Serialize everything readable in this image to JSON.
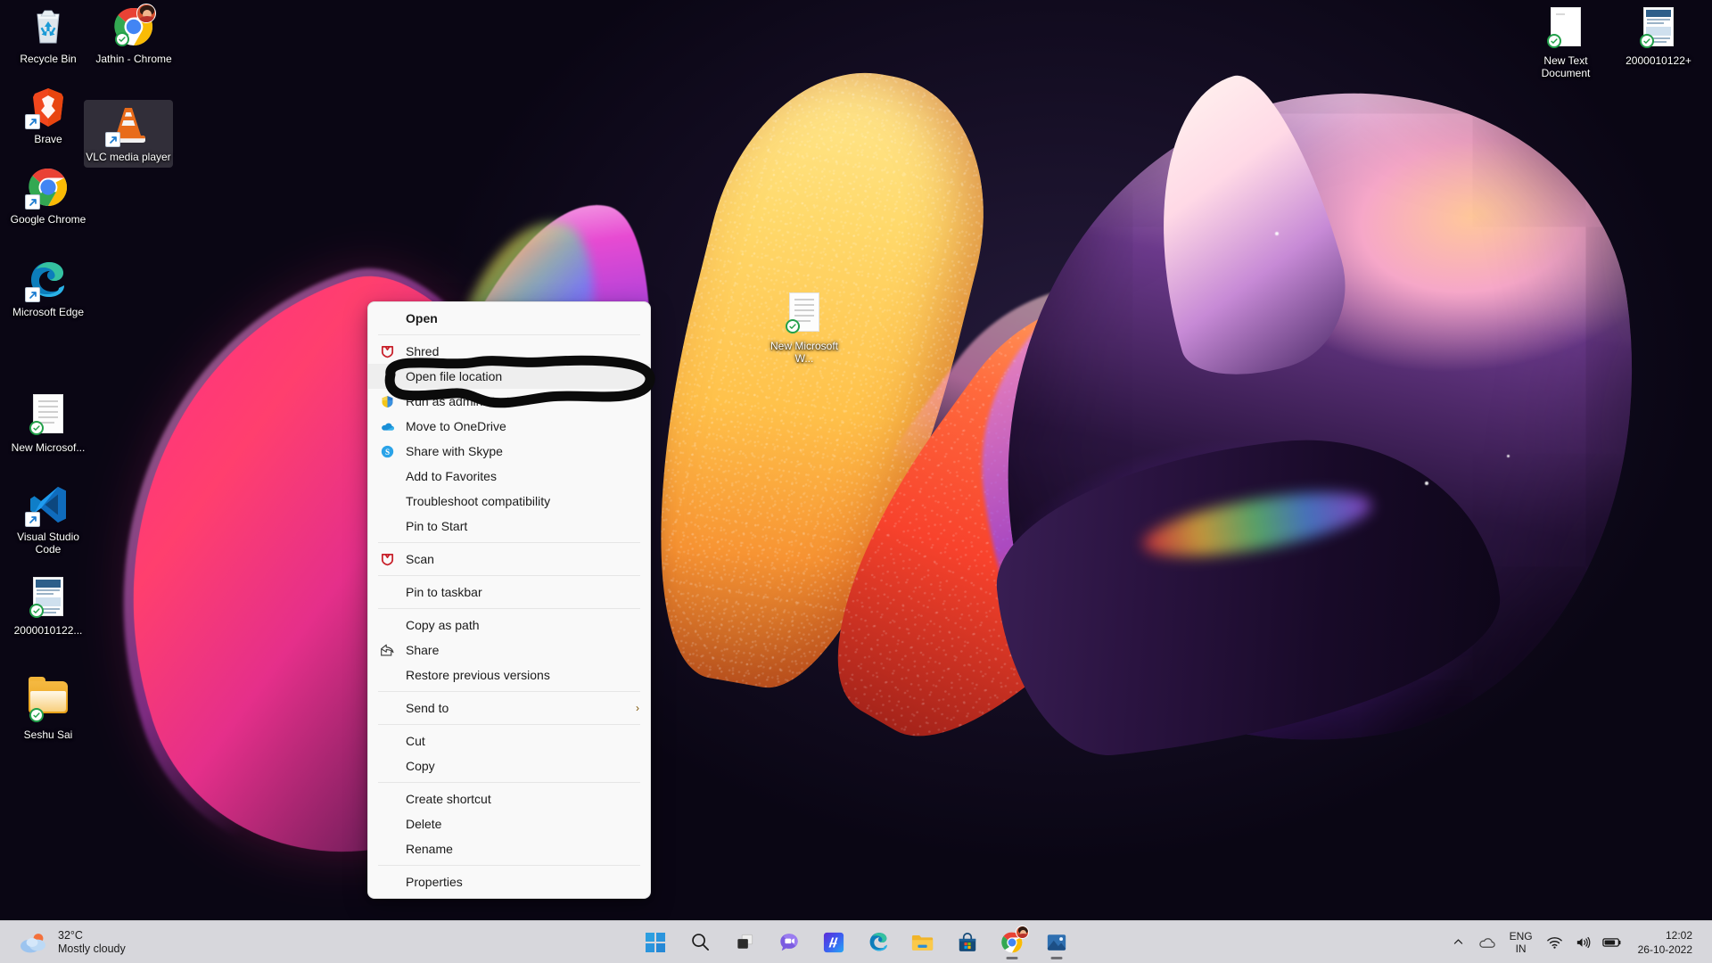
{
  "desktop": {
    "icons_left": [
      {
        "id": "recycle-bin",
        "label": "Recycle Bin",
        "type": "recycle",
        "shortcut": false,
        "sync": false,
        "selected": false
      },
      {
        "id": "brave",
        "label": "Brave",
        "type": "brave",
        "shortcut": true,
        "sync": false,
        "selected": false
      },
      {
        "id": "google-chrome",
        "label": "Google Chrome",
        "type": "chrome",
        "shortcut": true,
        "sync": false,
        "selected": false
      },
      {
        "id": "microsoft-edge",
        "label": "Microsoft Edge",
        "type": "edge",
        "shortcut": true,
        "sync": false,
        "selected": false
      },
      {
        "id": "new-microsoft-doc",
        "label": "New Microsof...",
        "type": "doc",
        "shortcut": false,
        "sync": true,
        "selected": false
      },
      {
        "id": "visual-studio-code",
        "label": "Visual Studio Code",
        "type": "vscode",
        "shortcut": true,
        "sync": false,
        "selected": false
      },
      {
        "id": "file-2000010122",
        "label": "2000010122...",
        "type": "image-doc",
        "shortcut": false,
        "sync": true,
        "selected": false
      },
      {
        "id": "seshu-sai-folder",
        "label": "Seshu Sai",
        "type": "folder",
        "shortcut": false,
        "sync": true,
        "selected": false
      }
    ],
    "icons_col2": [
      {
        "id": "jathin-chrome",
        "label": "Jathin - Chrome",
        "type": "chrome-profile",
        "shortcut": false,
        "sync": true,
        "selected": false
      },
      {
        "id": "vlc-media-player",
        "label": "VLC media player",
        "type": "vlc",
        "shortcut": true,
        "sync": false,
        "selected": true
      }
    ],
    "icons_center": [
      {
        "id": "new-microsoft-word",
        "label": "New Microsoft W...",
        "type": "doc",
        "shortcut": false,
        "sync": true,
        "selected": false
      }
    ],
    "icons_right": [
      {
        "id": "new-text-document",
        "label": "New Text Document",
        "type": "txt",
        "shortcut": false,
        "sync": true,
        "selected": false
      },
      {
        "id": "file-2000010122-plus",
        "label": "2000010122+",
        "type": "image-doc",
        "shortcut": false,
        "sync": true,
        "selected": false
      }
    ]
  },
  "context_menu": {
    "items": [
      {
        "label": "Open",
        "icon": "none",
        "bold": true,
        "highlighted": false,
        "submenu": false
      },
      {
        "separator": true
      },
      {
        "label": "Shred",
        "icon": "mcafee-shield",
        "bold": false,
        "highlighted": false,
        "submenu": false
      },
      {
        "label": "Open file location",
        "icon": "none",
        "bold": false,
        "highlighted": true,
        "submenu": false
      },
      {
        "label": "Run as administrator",
        "icon": "uac-shield",
        "bold": false,
        "highlighted": false,
        "submenu": false
      },
      {
        "label": "Move to OneDrive",
        "icon": "onedrive-cloud",
        "bold": false,
        "highlighted": false,
        "submenu": false
      },
      {
        "label": "Share with Skype",
        "icon": "skype",
        "bold": false,
        "highlighted": false,
        "submenu": false
      },
      {
        "label": "Add to Favorites",
        "icon": "none",
        "bold": false,
        "highlighted": false,
        "submenu": false
      },
      {
        "label": "Troubleshoot compatibility",
        "icon": "none",
        "bold": false,
        "highlighted": false,
        "submenu": false
      },
      {
        "label": "Pin to Start",
        "icon": "none",
        "bold": false,
        "highlighted": false,
        "submenu": false
      },
      {
        "separator": true
      },
      {
        "label": "Scan",
        "icon": "mcafee-shield",
        "bold": false,
        "highlighted": false,
        "submenu": false
      },
      {
        "separator": true
      },
      {
        "label": "Pin to taskbar",
        "icon": "none",
        "bold": false,
        "highlighted": false,
        "submenu": false
      },
      {
        "separator": true
      },
      {
        "label": "Copy as path",
        "icon": "none",
        "bold": false,
        "highlighted": false,
        "submenu": false
      },
      {
        "label": "Share",
        "icon": "share-arrow",
        "bold": false,
        "highlighted": false,
        "submenu": false
      },
      {
        "label": "Restore previous versions",
        "icon": "none",
        "bold": false,
        "highlighted": false,
        "submenu": false
      },
      {
        "separator": true
      },
      {
        "label": "Send to",
        "icon": "none",
        "bold": false,
        "highlighted": false,
        "submenu": true
      },
      {
        "separator": true
      },
      {
        "label": "Cut",
        "icon": "none",
        "bold": false,
        "highlighted": false,
        "submenu": false
      },
      {
        "label": "Copy",
        "icon": "none",
        "bold": false,
        "highlighted": false,
        "submenu": false
      },
      {
        "separator": true
      },
      {
        "label": "Create shortcut",
        "icon": "none",
        "bold": false,
        "highlighted": false,
        "submenu": false
      },
      {
        "label": "Delete",
        "icon": "none",
        "bold": false,
        "highlighted": false,
        "submenu": false
      },
      {
        "label": "Rename",
        "icon": "none",
        "bold": false,
        "highlighted": false,
        "submenu": false
      },
      {
        "separator": true
      },
      {
        "label": "Properties",
        "icon": "none",
        "bold": false,
        "highlighted": false,
        "submenu": false
      }
    ],
    "submenu_chevron": "›"
  },
  "annotation": {
    "kind": "hand-drawn-circle",
    "targets": "Open file location",
    "color": "#0a0a0a"
  },
  "taskbar": {
    "weather": {
      "temperature": "32°C",
      "condition": "Mostly cloudy",
      "icon": "sun-behind-cloud-icon"
    },
    "center_buttons": [
      {
        "id": "start",
        "name": "start-button",
        "label": "Start",
        "icon": "windows-logo",
        "active": false
      },
      {
        "id": "search",
        "name": "search-button",
        "label": "Search",
        "icon": "magnifier",
        "active": false
      },
      {
        "id": "task-view",
        "name": "task-view-button",
        "label": "Task View",
        "icon": "task-view",
        "active": false
      },
      {
        "id": "chat",
        "name": "chat-button",
        "label": "Chat",
        "icon": "chat-bubble",
        "active": false
      },
      {
        "id": "mi-browser",
        "name": "mi-app-button",
        "label": "M",
        "icon": "m-tile",
        "active": false
      },
      {
        "id": "edge",
        "name": "edge-button",
        "label": "Microsoft Edge",
        "icon": "edge",
        "active": false
      },
      {
        "id": "file-explorer",
        "name": "file-explorer-button",
        "label": "File Explorer",
        "icon": "folder",
        "active": false
      },
      {
        "id": "microsoft-store",
        "name": "store-button",
        "label": "Microsoft Store",
        "icon": "store-bag",
        "active": false
      },
      {
        "id": "chrome",
        "name": "chrome-button",
        "label": "Google Chrome",
        "icon": "chrome-profile",
        "active": true
      },
      {
        "id": "photos",
        "name": "photos-button",
        "label": "Photos",
        "icon": "photos",
        "active": true
      }
    ],
    "tray": {
      "show_hidden": "show-hidden-icons-chevron",
      "onedrive": "onedrive-cloud-icon",
      "language": {
        "line1": "ENG",
        "line2": "IN"
      },
      "wifi": "wifi-icon",
      "volume": "volume-icon",
      "battery": "battery-icon"
    },
    "clock": {
      "time": "12:02",
      "date": "26-10-2022"
    }
  }
}
